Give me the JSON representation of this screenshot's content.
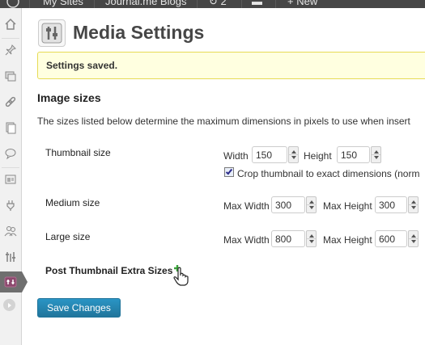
{
  "admin_bar": {
    "wp_label": "W",
    "my_sites": "My Sites",
    "blog_name": "Journal.me Blogs",
    "updates": "2",
    "new": "New"
  },
  "page": {
    "title": "Media Settings",
    "notice": "Settings saved."
  },
  "image_sizes": {
    "heading": "Image sizes",
    "description": "The sizes listed below determine the maximum dimensions in pixels to use when insert",
    "thumbnail": {
      "label": "Thumbnail size",
      "width_label": "Width",
      "width": "150",
      "height_label": "Height",
      "height": "150",
      "crop_label": "Crop thumbnail to exact dimensions (norm",
      "crop_checked": true
    },
    "medium": {
      "label": "Medium size",
      "max_width_label": "Max Width",
      "max_width": "300",
      "max_height_label": "Max Height",
      "max_height": "300"
    },
    "large": {
      "label": "Large size",
      "max_width_label": "Max Width",
      "max_width": "800",
      "max_height_label": "Max Height",
      "max_height": "600"
    },
    "post_thumbnail_extra": "Post Thumbnail Extra Sizes"
  },
  "actions": {
    "save": "Save Changes"
  },
  "colors": {
    "admin_bar": "#464646",
    "notice_bg": "#ffffe0",
    "notice_border": "#e6db55",
    "button": "#21759b",
    "active_menu": "#8e4a6f"
  },
  "sidebar_icons": [
    "dashboard-icon",
    "pin-icon",
    "media-icon",
    "links-icon",
    "pages-icon",
    "comments-icon",
    "appearance-icon",
    "plugins-icon",
    "users-icon",
    "tools-icon",
    "settings-icon",
    "collapse-icon"
  ]
}
